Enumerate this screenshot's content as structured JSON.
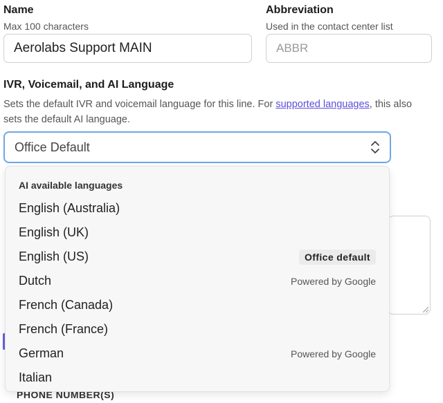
{
  "name_field": {
    "label": "Name",
    "help": "Max 100 characters",
    "value": "Aerolabs Support MAIN"
  },
  "abbreviation_field": {
    "label": "Abbreviation",
    "help": "Used in the contact center list",
    "placeholder": "ABBR"
  },
  "language_field": {
    "label": "IVR, Voicemail, and AI Language",
    "desc_before": "Sets the default IVR and voicemail language for this line. For ",
    "desc_link": "supported languages",
    "desc_after": ", this also sets the default AI language.",
    "selected": "Office Default"
  },
  "dropdown": {
    "header": "AI available languages",
    "items": [
      {
        "label": "English (Australia)",
        "note": ""
      },
      {
        "label": "English (UK)",
        "note": ""
      },
      {
        "label": "English (US)",
        "badge": "Office default"
      },
      {
        "label": "Dutch",
        "note": "Powered by Google"
      },
      {
        "label": "French (Canada)",
        "note": ""
      },
      {
        "label": "French (France)",
        "note": ""
      },
      {
        "label": "German",
        "note": "Powered by Google"
      },
      {
        "label": "Italian",
        "note": ""
      }
    ]
  },
  "background": {
    "phone_heading": "PHONE NUMBER(S)"
  },
  "colors": {
    "accent": "#5b4fd8",
    "focus_border": "#6ea6e6",
    "dropdown_bg": "#f7f7f7"
  }
}
